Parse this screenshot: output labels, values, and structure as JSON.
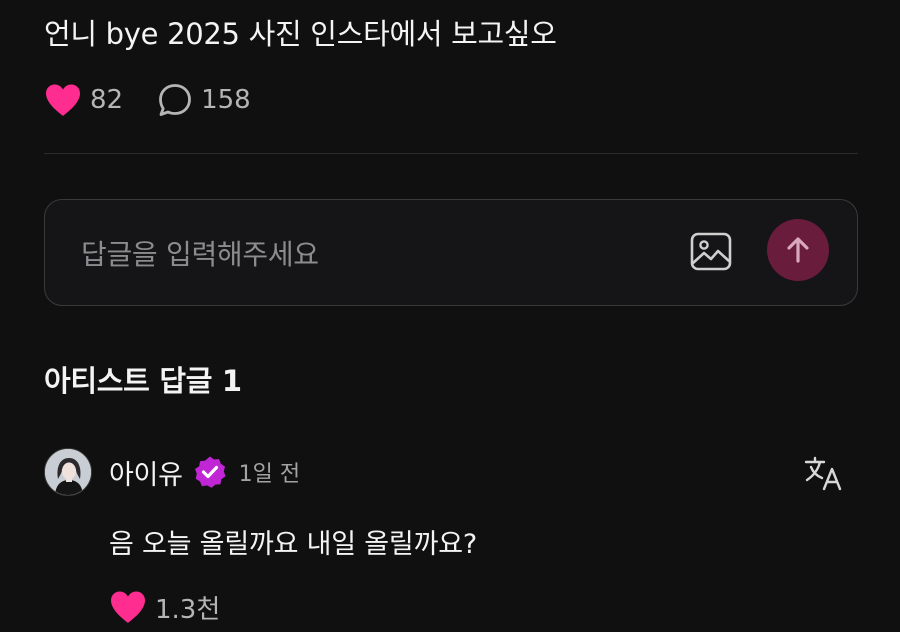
{
  "post": {
    "text": "언니 bye 2025 사진 인스타에서 보고싶오",
    "likes": "82",
    "comments": "158"
  },
  "reply": {
    "placeholder": "답글을 입력해주세요"
  },
  "artist_replies": {
    "title": "아티스트 답글 1",
    "items": [
      {
        "author": "아이유",
        "time": "1일 전",
        "text": "음 오늘 올릴까요 내일 올릴까요?",
        "likes": "1.3천"
      }
    ]
  },
  "colors": {
    "background": "#111011",
    "heart": "#ff2d8f",
    "send_button": "#6a1c3d",
    "verified_badge": "#c026d3"
  },
  "icons": [
    "heart-icon",
    "comment-bubble-icon",
    "image-icon",
    "arrow-up-icon",
    "verified-badge-icon",
    "translate-icon"
  ]
}
